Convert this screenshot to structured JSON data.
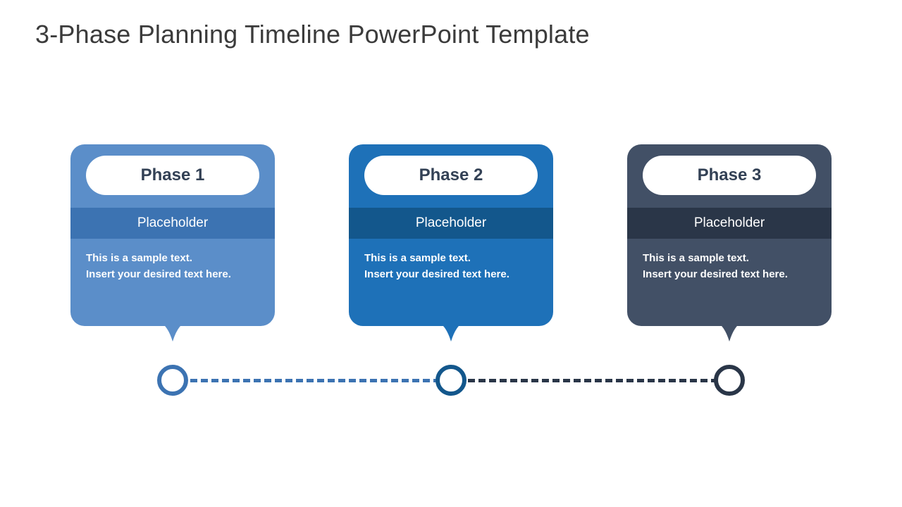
{
  "title": "3-Phase Planning Timeline PowerPoint Template",
  "phases": [
    {
      "name": "Phase 1",
      "label": "Placeholder",
      "line1": "This is a sample text.",
      "line2": "Insert your desired text here.",
      "color": "#5B8EC9",
      "band": "#3C73B2",
      "node": "#3C73B2"
    },
    {
      "name": "Phase 2",
      "label": "Placeholder",
      "line1": "This is a sample text.",
      "line2": "Insert your desired text here.",
      "color": "#1E71B8",
      "band": "#13578C",
      "node": "#13578C"
    },
    {
      "name": "Phase 3",
      "label": "Placeholder",
      "line1": "This is a sample text.",
      "line2": "Insert your desired text here.",
      "color": "#425066",
      "band": "#2A3648",
      "node": "#2A3648"
    }
  ]
}
